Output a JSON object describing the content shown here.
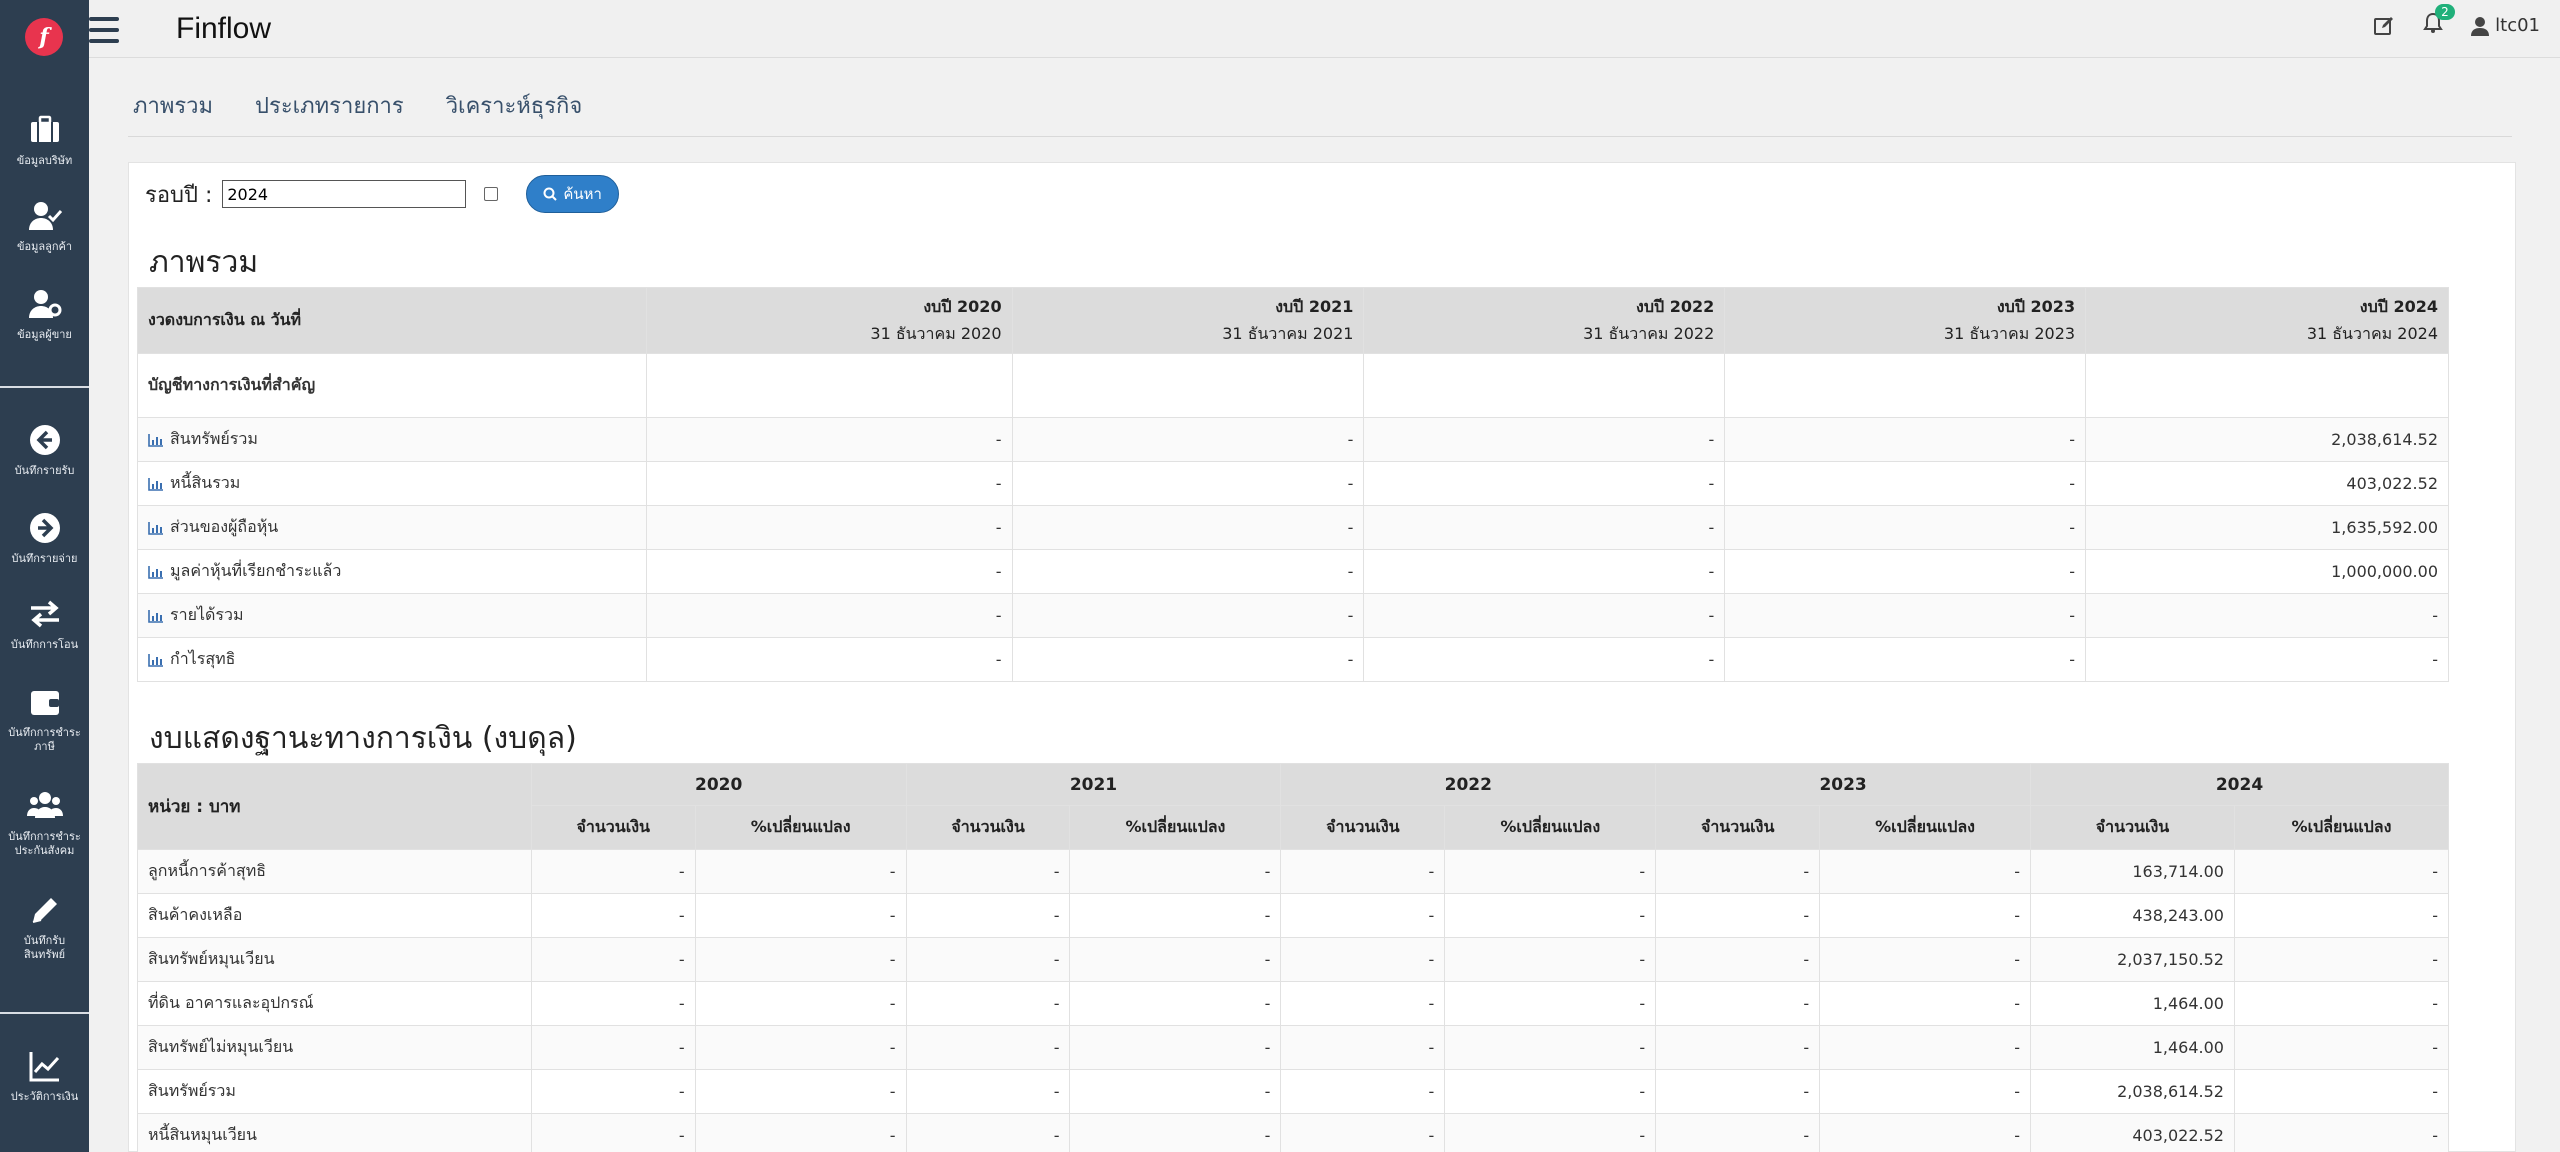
{
  "app": {
    "brand": "Finflow",
    "user": "ltc01",
    "notifications": "2"
  },
  "sidebar": {
    "items": [
      {
        "label": "ข้อมูลบริษัท",
        "icon": "briefcase-icon"
      },
      {
        "label": "ข้อมูลลูกค้า",
        "icon": "user-check-icon"
      },
      {
        "label": "ข้อมูลผู้ขาย",
        "icon": "user-gear-icon"
      },
      {
        "label": "บันทึกรายรับ",
        "icon": "arrow-left-circle-icon"
      },
      {
        "label": "บันทึกรายจ่าย",
        "icon": "arrow-right-circle-icon"
      },
      {
        "label": "บันทึกการโอน",
        "icon": "exchange-icon"
      },
      {
        "label": "บันทึกการชำระภาษี",
        "icon": "wallet-icon"
      },
      {
        "label": "บันทึกการชำระประกันสังคม",
        "icon": "users-icon"
      },
      {
        "label": "บันทึกรับสินทรัพย์",
        "icon": "pencil-icon"
      },
      {
        "label": "ประวัติการเงิน",
        "icon": "line-chart-icon"
      }
    ]
  },
  "tabs": [
    "ภาพรวม",
    "ประเภทรายการ",
    "วิเคราะห์ธุรกิจ"
  ],
  "filter": {
    "label": "รอบปี :",
    "year_value": "2024",
    "search_label": "ค้นหา"
  },
  "overview": {
    "title": "ภาพรวม",
    "header_first": "งวดงบการเงิน ณ วันที่",
    "periods": [
      {
        "label": "งบปี 2020",
        "date": "31 ธันวาคม 2020"
      },
      {
        "label": "งบปี 2021",
        "date": "31 ธันวาคม 2021"
      },
      {
        "label": "งบปี 2022",
        "date": "31 ธันวาคม 2022"
      },
      {
        "label": "งบปี 2023",
        "date": "31 ธันวาคม 2023"
      },
      {
        "label": "งบปี 2024",
        "date": "31 ธันวาคม 2024"
      }
    ],
    "group_label": "บัญชีทางการเงินที่สำคัญ",
    "rows": [
      {
        "label": "สินทรัพย์รวม",
        "values": [
          "-",
          "-",
          "-",
          "-",
          "2,038,614.52"
        ]
      },
      {
        "label": "หนี้สินรวม",
        "values": [
          "-",
          "-",
          "-",
          "-",
          "403,022.52"
        ]
      },
      {
        "label": "ส่วนของผู้ถือหุ้น",
        "values": [
          "-",
          "-",
          "-",
          "-",
          "1,635,592.00"
        ]
      },
      {
        "label": "มูลค่าหุ้นที่เรียกชำระแล้ว",
        "values": [
          "-",
          "-",
          "-",
          "-",
          "1,000,000.00"
        ]
      },
      {
        "label": "รายได้รวม",
        "values": [
          "-",
          "-",
          "-",
          "-",
          "-"
        ]
      },
      {
        "label": "กำไรสุทธิ",
        "values": [
          "-",
          "-",
          "-",
          "-",
          "-"
        ]
      }
    ]
  },
  "balance": {
    "title": "งบแสดงฐานะทางการเงิน (งบดุล)",
    "unit": "หน่วย : บาท",
    "years": [
      "2020",
      "2021",
      "2022",
      "2023",
      "2024"
    ],
    "col_amount": "จำนวนเงิน",
    "col_change": "%เปลี่ยนแปลง",
    "rows": [
      {
        "label": "ลูกหนี้การค้าสุทธิ",
        "values": [
          "-",
          "-",
          "-",
          "-",
          "-",
          "-",
          "-",
          "-",
          "163,714.00",
          "-"
        ]
      },
      {
        "label": "สินค้าคงเหลือ",
        "values": [
          "-",
          "-",
          "-",
          "-",
          "-",
          "-",
          "-",
          "-",
          "438,243.00",
          "-"
        ]
      },
      {
        "label": "สินทรัพย์หมุนเวียน",
        "values": [
          "-",
          "-",
          "-",
          "-",
          "-",
          "-",
          "-",
          "-",
          "2,037,150.52",
          "-"
        ]
      },
      {
        "label": "ที่ดิน อาคารและอุปกรณ์",
        "values": [
          "-",
          "-",
          "-",
          "-",
          "-",
          "-",
          "-",
          "-",
          "1,464.00",
          "-"
        ]
      },
      {
        "label": "สินทรัพย์ไม่หมุนเวียน",
        "values": [
          "-",
          "-",
          "-",
          "-",
          "-",
          "-",
          "-",
          "-",
          "1,464.00",
          "-"
        ]
      },
      {
        "label": "สินทรัพย์รวม",
        "values": [
          "-",
          "-",
          "-",
          "-",
          "-",
          "-",
          "-",
          "-",
          "2,038,614.52",
          "-"
        ]
      },
      {
        "label": "หนี้สินหมุนเวียน",
        "values": [
          "-",
          "-",
          "-",
          "-",
          "-",
          "-",
          "-",
          "-",
          "403,022.52",
          "-"
        ]
      }
    ]
  },
  "colors": {
    "sidebar": "#2d3e50",
    "logo": "#e8344e",
    "accent": "#2f7fc9",
    "badge": "#20b07a"
  }
}
